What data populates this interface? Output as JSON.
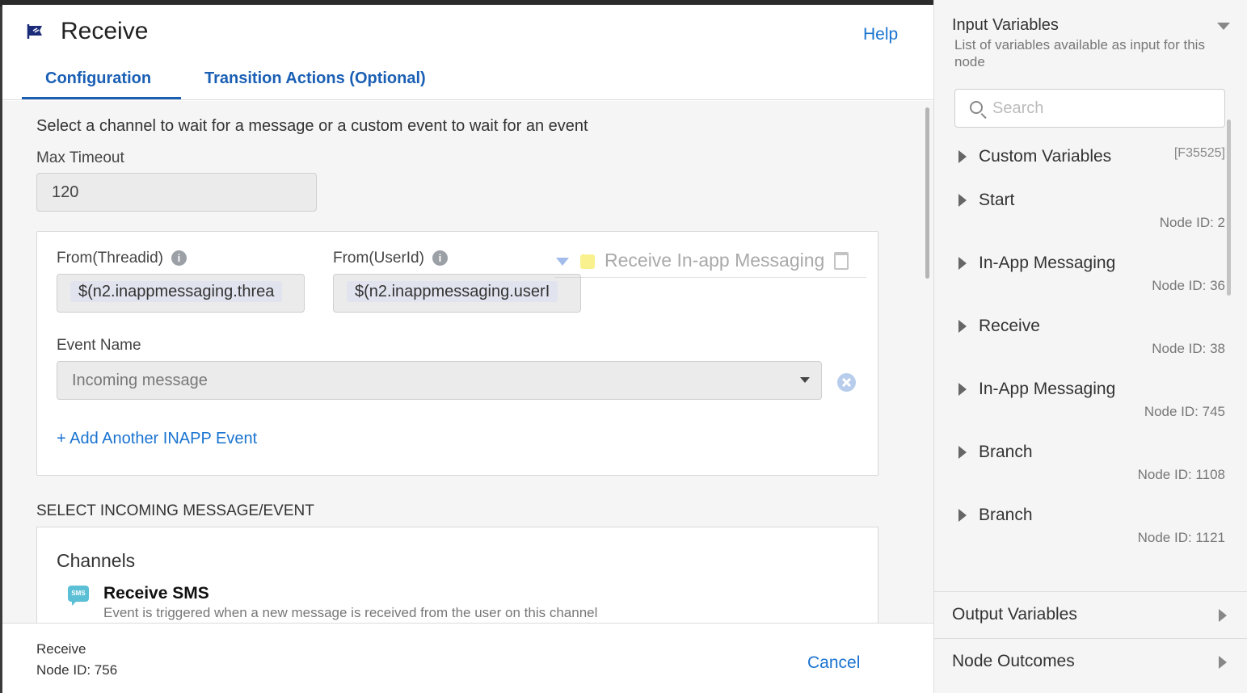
{
  "dialog": {
    "title": "Receive",
    "help_label": "Help",
    "tabs": [
      {
        "label": "Configuration",
        "active": true
      },
      {
        "label": "Transition Actions (Optional)",
        "active": false
      }
    ],
    "accent_color": "#1a5fb4"
  },
  "config": {
    "intro_text": "Select a channel to wait for a message or a custom event to wait for an event",
    "max_timeout_label": "Max Timeout",
    "max_timeout_value": "120",
    "from_threadid_label": "From(Threadid)",
    "from_threadid_value": "$(n2.inappmessaging.threa",
    "from_userid_label": "From(UserId)",
    "from_userid_value": "$(n2.inappmessaging.userI",
    "drag_ghost_text": "Receive In-app Messaging",
    "event_name_label": "Event Name",
    "event_name_value": "Incoming message",
    "add_event_label": "+ Add Another INAPP Event"
  },
  "incoming": {
    "section_title": "SELECT INCOMING MESSAGE/EVENT",
    "channels_title": "Channels",
    "channels": [
      {
        "icon": "sms-icon",
        "icon_text": "SMS",
        "name": "Receive SMS",
        "description": "Event is triggered when a new message is received from the user on this channel"
      }
    ]
  },
  "footer": {
    "node_name": "Receive",
    "node_id": "Node ID: 756",
    "cancel_label": "Cancel"
  },
  "input_panel": {
    "title": "Input Variables",
    "subtitle": "List of variables available as input for this node",
    "search_placeholder": "Search",
    "items": [
      {
        "name": "Custom Variables",
        "badge": "[F35525]",
        "meta": ""
      },
      {
        "name": "Start",
        "badge": "",
        "meta": "Node ID: 2"
      },
      {
        "name": "In-App Messaging",
        "badge": "",
        "meta": "Node ID: 36"
      },
      {
        "name": "Receive",
        "badge": "",
        "meta": "Node ID: 38"
      },
      {
        "name": "In-App Messaging",
        "badge": "",
        "meta": "Node ID: 745"
      },
      {
        "name": "Branch",
        "badge": "",
        "meta": "Node ID: 1108"
      },
      {
        "name": "Branch",
        "badge": "",
        "meta": "Node ID: 1121"
      }
    ],
    "output_label": "Output Variables",
    "outcomes_label": "Node Outcomes"
  }
}
